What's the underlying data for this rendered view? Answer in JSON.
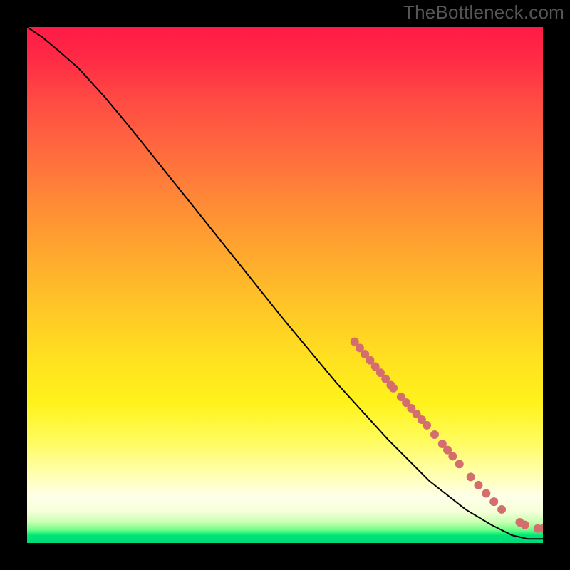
{
  "watermark": "TheBottleneck.com",
  "colors": {
    "frame": "#000000",
    "curve": "#000000",
    "marker": "#d46e6e",
    "gradient_stops": [
      "#ff1a46",
      "#ff4a44",
      "#ff8a36",
      "#ffc527",
      "#fff31c",
      "#ffffa8",
      "#c8ffb0",
      "#00d97a"
    ]
  },
  "chart_data": {
    "type": "line",
    "title": "",
    "xlabel": "",
    "ylabel": "",
    "xlim": [
      0,
      100
    ],
    "ylim": [
      0,
      100
    ],
    "grid": false,
    "curve": [
      {
        "x": 0,
        "y": 100
      },
      {
        "x": 3,
        "y": 98
      },
      {
        "x": 6,
        "y": 95.5
      },
      {
        "x": 10,
        "y": 92
      },
      {
        "x": 15,
        "y": 86.5
      },
      {
        "x": 20,
        "y": 80.5
      },
      {
        "x": 30,
        "y": 68
      },
      {
        "x": 40,
        "y": 55.5
      },
      {
        "x": 50,
        "y": 43
      },
      {
        "x": 60,
        "y": 31
      },
      {
        "x": 70,
        "y": 20
      },
      {
        "x": 78,
        "y": 12
      },
      {
        "x": 85,
        "y": 6.5
      },
      {
        "x": 90,
        "y": 3.5
      },
      {
        "x": 94,
        "y": 1.5
      },
      {
        "x": 97,
        "y": 0.8
      },
      {
        "x": 100,
        "y": 0.8
      }
    ],
    "markers": [
      {
        "x": 63.5,
        "y": 39.0,
        "r": 6
      },
      {
        "x": 64.5,
        "y": 37.8,
        "r": 6
      },
      {
        "x": 65.5,
        "y": 36.6,
        "r": 6
      },
      {
        "x": 66.5,
        "y": 35.4,
        "r": 6
      },
      {
        "x": 67.5,
        "y": 34.2,
        "r": 6
      },
      {
        "x": 68.5,
        "y": 33.0,
        "r": 6
      },
      {
        "x": 69.5,
        "y": 31.8,
        "r": 6
      },
      {
        "x": 70.5,
        "y": 30.6,
        "r": 6
      },
      {
        "x": 71.0,
        "y": 30.0,
        "r": 6
      },
      {
        "x": 72.5,
        "y": 28.3,
        "r": 6
      },
      {
        "x": 73.5,
        "y": 27.2,
        "r": 6
      },
      {
        "x": 74.5,
        "y": 26.1,
        "r": 6
      },
      {
        "x": 75.5,
        "y": 25.0,
        "r": 6
      },
      {
        "x": 76.5,
        "y": 23.9,
        "r": 6
      },
      {
        "x": 77.5,
        "y": 22.8,
        "r": 6
      },
      {
        "x": 79.0,
        "y": 21.0,
        "r": 6
      },
      {
        "x": 80.5,
        "y": 19.2,
        "r": 6
      },
      {
        "x": 81.5,
        "y": 18.0,
        "r": 6
      },
      {
        "x": 82.5,
        "y": 16.8,
        "r": 6
      },
      {
        "x": 83.8,
        "y": 15.3,
        "r": 6
      },
      {
        "x": 86.0,
        "y": 12.8,
        "r": 6
      },
      {
        "x": 87.5,
        "y": 11.2,
        "r": 6
      },
      {
        "x": 89.0,
        "y": 9.6,
        "r": 6
      },
      {
        "x": 90.5,
        "y": 8.0,
        "r": 6
      },
      {
        "x": 92.0,
        "y": 6.5,
        "r": 6
      },
      {
        "x": 95.5,
        "y": 4.0,
        "r": 6
      },
      {
        "x": 96.5,
        "y": 3.5,
        "r": 6
      },
      {
        "x": 99.0,
        "y": 2.8,
        "r": 6
      },
      {
        "x": 100.0,
        "y": 2.8,
        "r": 6
      }
    ]
  }
}
